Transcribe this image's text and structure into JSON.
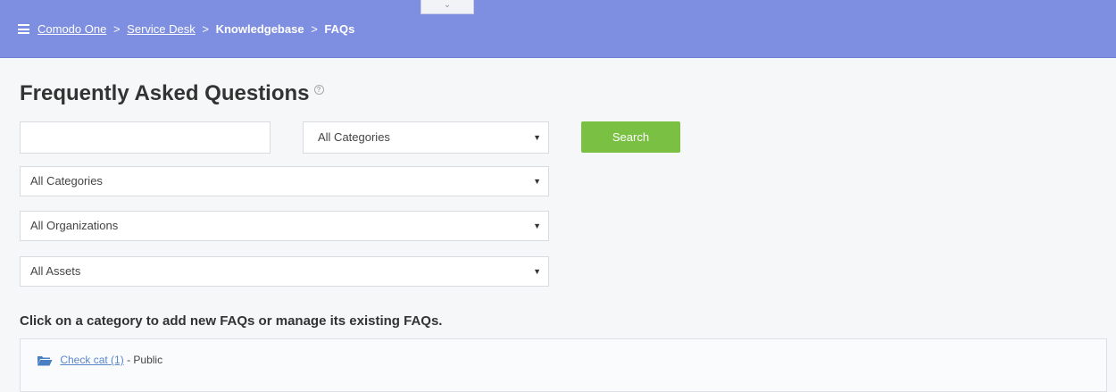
{
  "header": {
    "breadcrumb": {
      "item1": "Comodo One",
      "item2": "Service Desk",
      "item3": "Knowledgebase",
      "current": "FAQs",
      "separator": ">"
    },
    "collapse_glyph": "⌄"
  },
  "page": {
    "title": "Frequently Asked Questions"
  },
  "search": {
    "input_value": "",
    "category_select": "All Categories",
    "button_label": "Search"
  },
  "filters": {
    "categories": "All Categories",
    "organizations": "All Organizations",
    "assets": "All Assets"
  },
  "instruction": "Click on a category to add new FAQs or manage its existing FAQs.",
  "categories": [
    {
      "name": "Check cat",
      "count": "(1)",
      "visibility": "- Public"
    }
  ],
  "colors": {
    "header_bg": "#7e8ee0",
    "search_button": "#7ac143",
    "link": "#5b86c9",
    "folder_icon": "#4a7fc1"
  },
  "icons": [
    "menu-icon",
    "help-icon",
    "dropdown-caret-icon",
    "folder-icon"
  ]
}
